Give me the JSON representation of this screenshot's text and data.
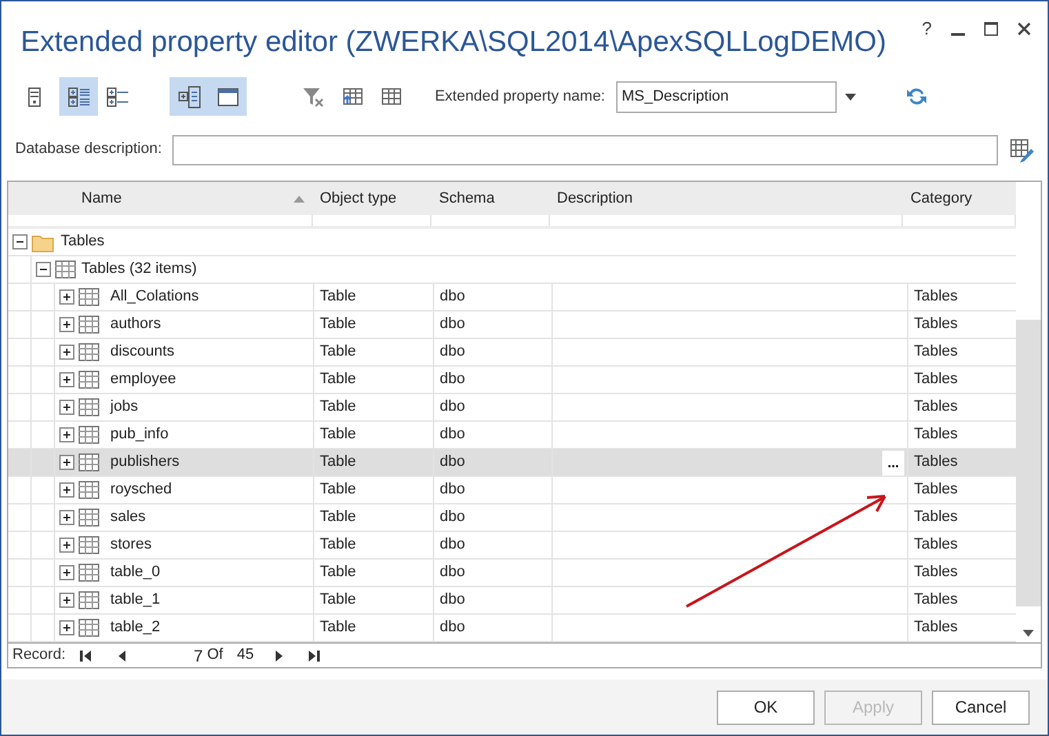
{
  "window": {
    "title": "Extended property editor (ZWERKA\\SQL2014\\ApexSQLLogDEMO)",
    "help": "?"
  },
  "toolbar": [
    {
      "kind": "server",
      "selected": false
    },
    {
      "kind": "tree-expanded",
      "selected": true
    },
    {
      "kind": "tree-collapsed",
      "selected": false
    },
    {
      "kind": "columns",
      "selected": true
    },
    {
      "kind": "window",
      "selected": true
    },
    {
      "kind": "clear-filter",
      "selected": false
    },
    {
      "kind": "export-grid",
      "selected": false
    },
    {
      "kind": "grid",
      "selected": false
    }
  ],
  "property_name": {
    "label": "Extended property name:",
    "value": "MS_Description"
  },
  "database_description": {
    "label": "Database description:"
  },
  "grid": {
    "columns": [
      {
        "label": "Name",
        "sorted": true
      },
      {
        "label": "Object type",
        "sorted": false
      },
      {
        "label": "Schema",
        "sorted": false
      },
      {
        "label": "Description",
        "sorted": false
      },
      {
        "label": "Category",
        "sorted": false
      }
    ],
    "groups": [
      {
        "label": "Tables",
        "expanded": true,
        "children": [
          {
            "label": "Tables (32 items)",
            "expanded": true,
            "children": [
              {
                "name": "All_Colations",
                "object_type": "Table",
                "schema": "dbo",
                "category": "Tables",
                "selected": false,
                "expanded": false
              },
              {
                "name": "authors",
                "object_type": "Table",
                "schema": "dbo",
                "category": "Tables",
                "selected": false,
                "expanded": false
              },
              {
                "name": "discounts",
                "object_type": "Table",
                "schema": "dbo",
                "category": "Tables",
                "selected": false,
                "expanded": false
              },
              {
                "name": "employee",
                "object_type": "Table",
                "schema": "dbo",
                "category": "Tables",
                "selected": false,
                "expanded": false
              },
              {
                "name": "jobs",
                "object_type": "Table",
                "schema": "dbo",
                "category": "Tables",
                "selected": false,
                "expanded": false
              },
              {
                "name": "pub_info",
                "object_type": "Table",
                "schema": "dbo",
                "category": "Tables",
                "selected": false,
                "expanded": false
              },
              {
                "name": "publishers",
                "object_type": "Table",
                "schema": "dbo",
                "category": "Tables",
                "selected": true,
                "expanded": false,
                "ellipsis": "..."
              },
              {
                "name": "roysched",
                "object_type": "Table",
                "schema": "dbo",
                "category": "Tables",
                "selected": false,
                "expanded": false
              },
              {
                "name": "sales",
                "object_type": "Table",
                "schema": "dbo",
                "category": "Tables",
                "selected": false,
                "expanded": false
              },
              {
                "name": "stores",
                "object_type": "Table",
                "schema": "dbo",
                "category": "Tables",
                "selected": false,
                "expanded": false
              },
              {
                "name": "table_0",
                "object_type": "Table",
                "schema": "dbo",
                "category": "Tables",
                "selected": false,
                "expanded": false
              },
              {
                "name": "table_1",
                "object_type": "Table",
                "schema": "dbo",
                "category": "Tables",
                "selected": false,
                "expanded": false
              },
              {
                "name": "table_2",
                "object_type": "Table",
                "schema": "dbo",
                "category": "Tables",
                "selected": false,
                "expanded": false
              }
            ]
          }
        ]
      }
    ]
  },
  "record": {
    "label": "Record:",
    "current": "7",
    "of": "Of",
    "total": "45"
  },
  "buttons": [
    {
      "label": "OK",
      "disabled": false
    },
    {
      "label": "Apply",
      "disabled": true
    },
    {
      "label": "Cancel",
      "disabled": false
    }
  ]
}
